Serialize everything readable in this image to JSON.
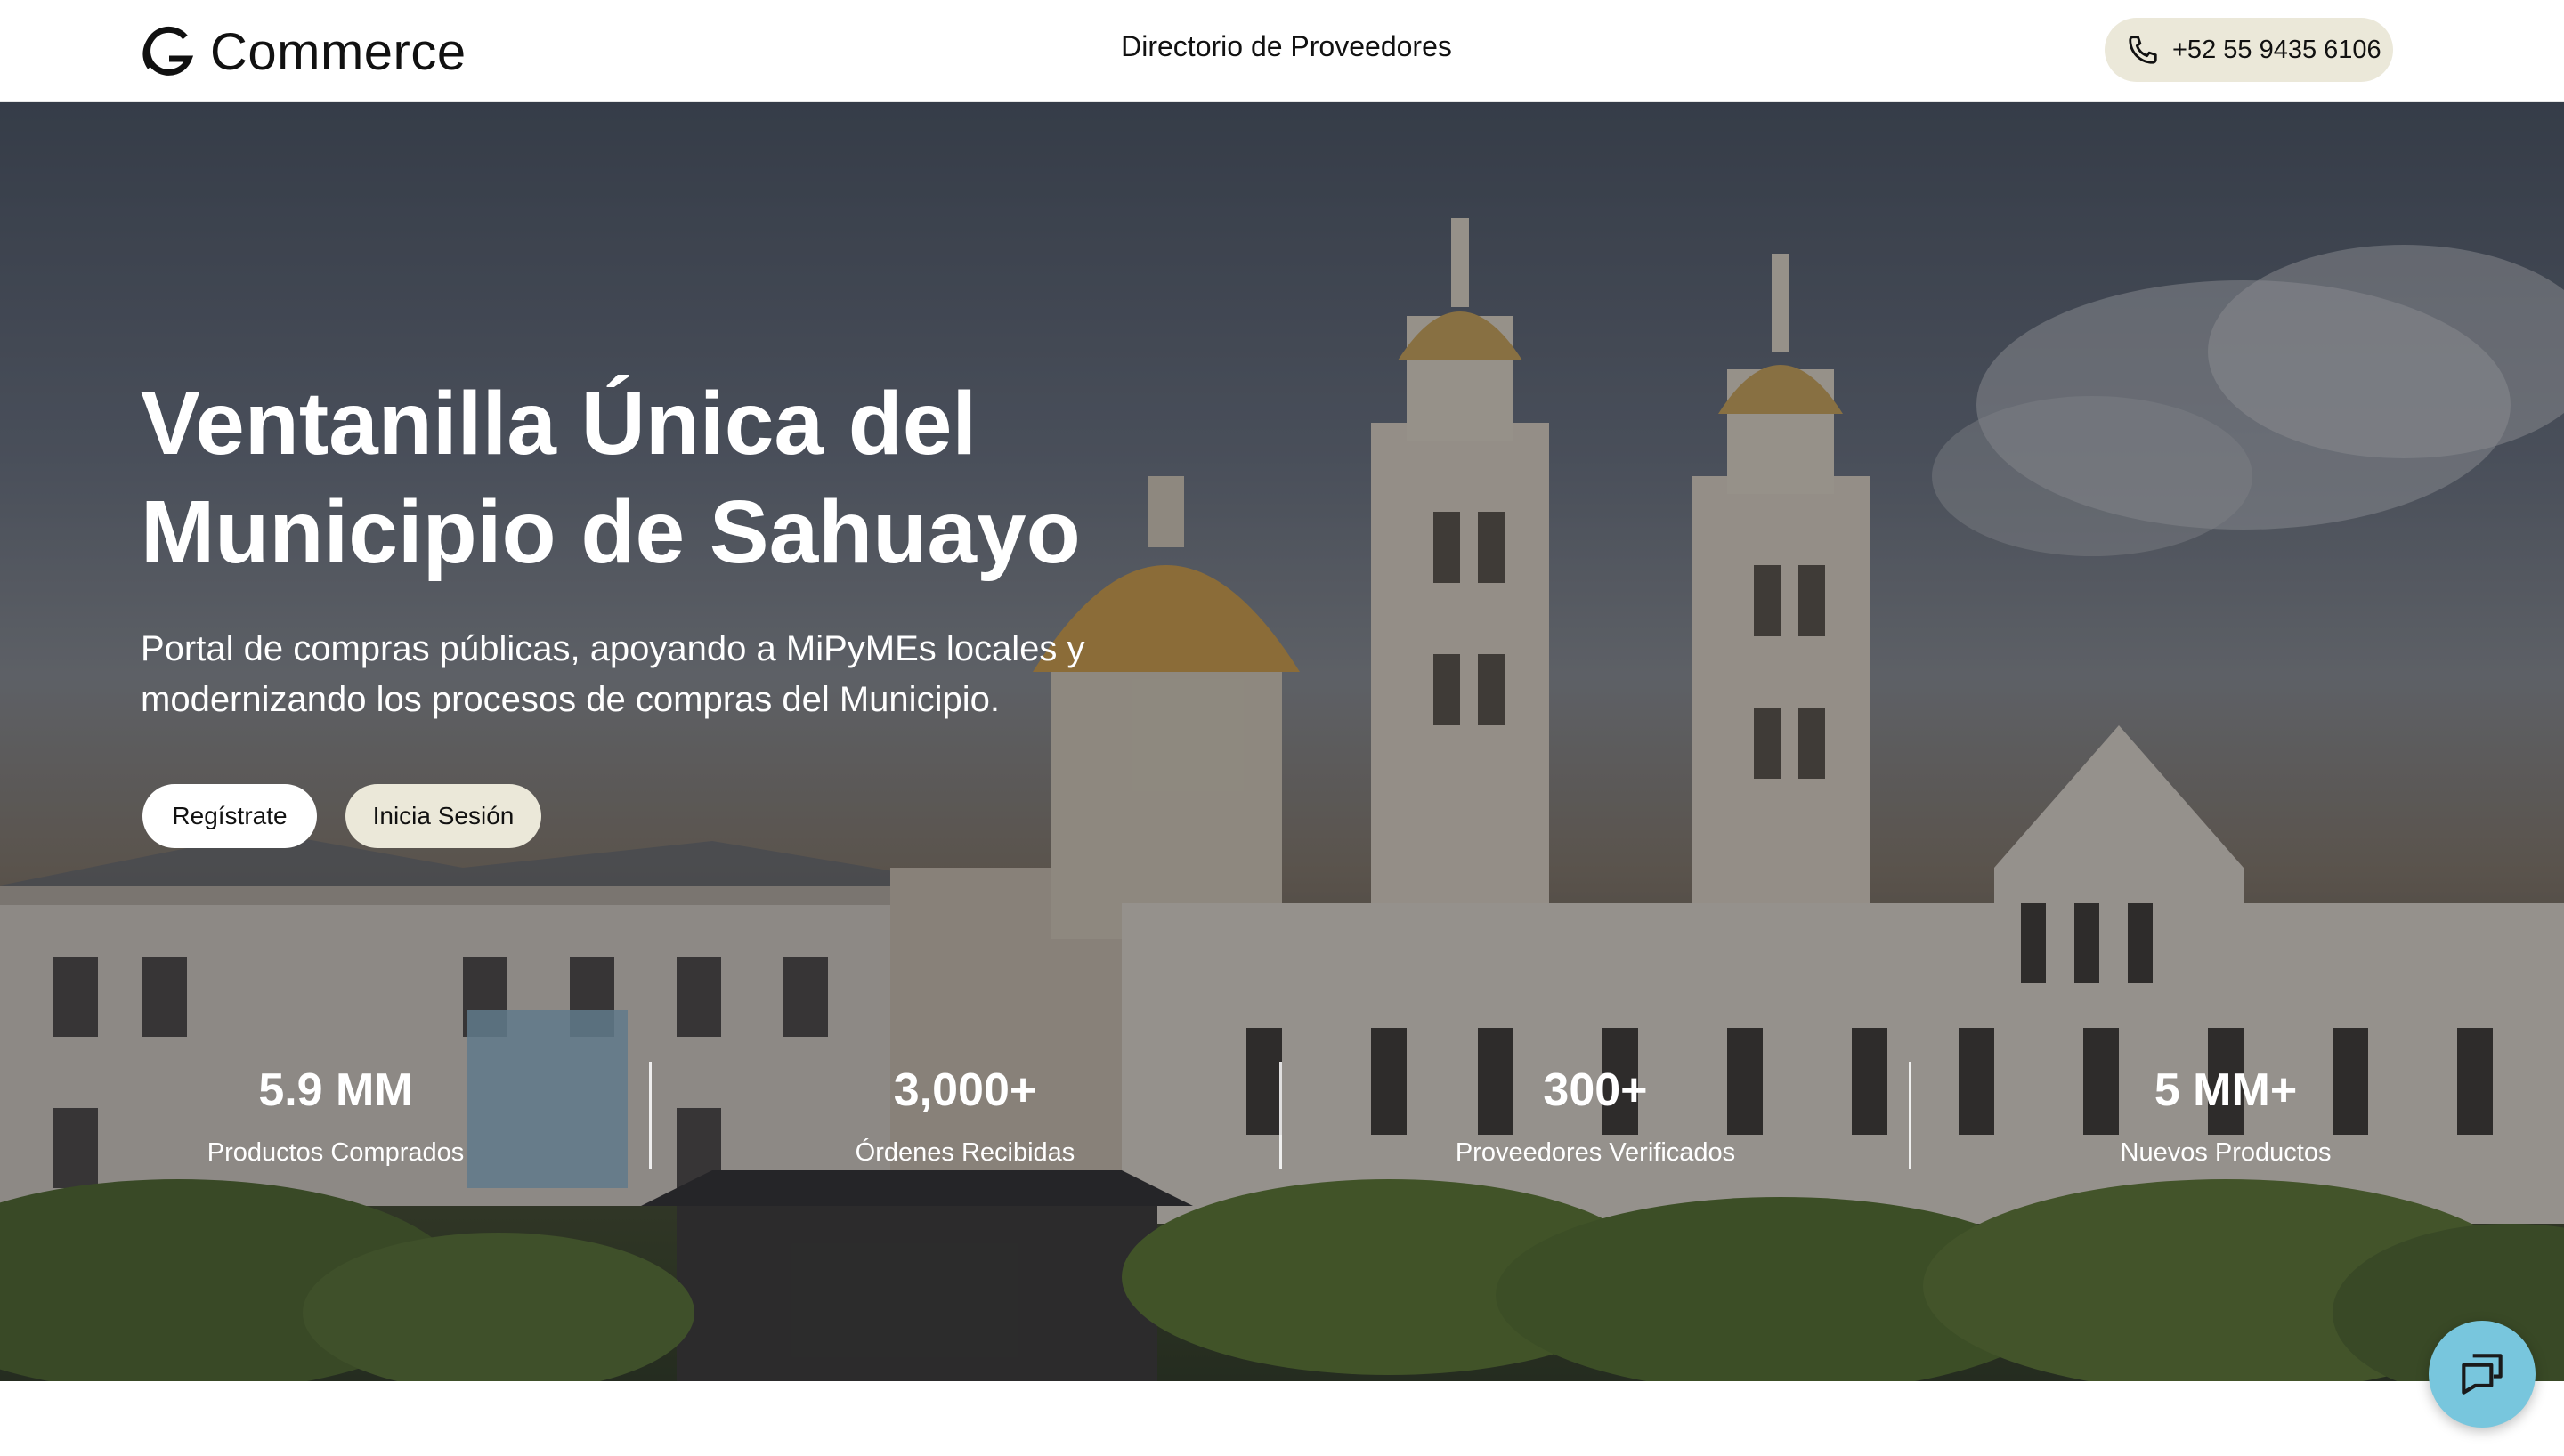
{
  "header": {
    "logo_text": "Commerce",
    "logo_icon": "g-logo-icon",
    "nav_link": "Directorio de Proveedores",
    "phone": "+52 55 9435 6106",
    "phone_icon": "phone-icon"
  },
  "hero": {
    "title_line1": "Ventanilla Única del",
    "title_line2": "Municipio de Sahuayo",
    "subtitle": "Portal de compras públicas, apoyando a MiPyMEs locales y modernizando los procesos de compras del Municipio.",
    "register_label": "Regístrate",
    "login_label": "Inicia Sesión",
    "background": "cathedral-photo"
  },
  "stats": [
    {
      "value": "5.9 MM",
      "label": "Productos Comprados"
    },
    {
      "value": "3,000+",
      "label": "Órdenes Recibidas"
    },
    {
      "value": "300+",
      "label": "Proveedores Verificados"
    },
    {
      "value": "5 MM+",
      "label": "Nuevos Productos"
    }
  ],
  "chat": {
    "icon": "chat-bubbles-icon"
  },
  "colors": {
    "pill": "#ebe8d9",
    "chat": "#78c6dd",
    "text": "#111111"
  }
}
